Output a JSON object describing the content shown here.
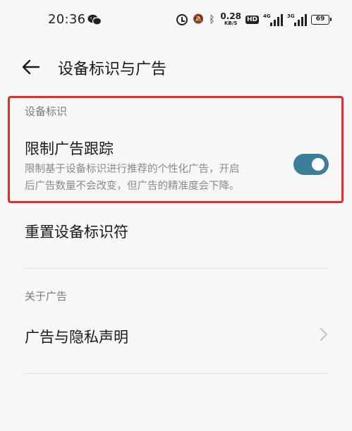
{
  "status_bar": {
    "time": "20:36",
    "speed_value": "0.28",
    "speed_unit": "KB/S",
    "hd": "HD",
    "signal_1_label": "4G",
    "signal_2_label": "3G",
    "battery": "69",
    "icons": [
      "wechat-icon",
      "alarm-icon",
      "mute-icon",
      "bluetooth-icon",
      "signal-icon",
      "battery-icon"
    ]
  },
  "header": {
    "title": "设备标识与广告"
  },
  "device_id_section": {
    "label": "设备标识",
    "limit_tracking": {
      "title": "限制广告跟踪",
      "desc_line1": "限制基于设备标识进行推荐的个性化广告，开启",
      "desc_line2": "后广告数量不会改变，但广告的精准度会下降。",
      "enabled": true,
      "toggle_color": "#3b7f99"
    },
    "reset_label": "重置设备标识符"
  },
  "ads_section": {
    "label": "关于广告",
    "privacy_label": "广告与隐私声明"
  },
  "highlight_color": "#e32c2c"
}
